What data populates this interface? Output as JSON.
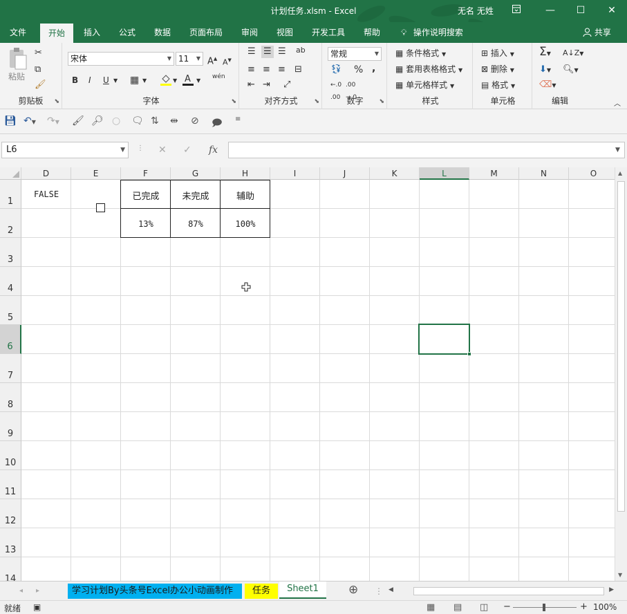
{
  "window": {
    "title": "计划任务.xlsm  -  Excel",
    "user": "无名 无姓",
    "ribbon_display_icon": "ribbon-display-icon",
    "minimize_glyph": "—",
    "maximize_glyph": "☐",
    "close_glyph": "✕"
  },
  "ribbon_tabs": [
    "文件",
    "开始",
    "插入",
    "公式",
    "数据",
    "页面布局",
    "审阅",
    "视图",
    "开发工具",
    "帮助"
  ],
  "active_tab": "开始",
  "tell_me": "操作说明搜索",
  "share": "共享",
  "ribbon": {
    "clipboard": {
      "label": "剪贴板",
      "paste": "粘贴"
    },
    "font": {
      "label": "字体",
      "font_name": "宋体",
      "font_size": "11",
      "bold": "B",
      "italic": "I",
      "underline": "U",
      "grow": "A",
      "shrink": "A",
      "wen": "wén"
    },
    "alignment": {
      "label": "对齐方式",
      "wrap": "ab"
    },
    "number": {
      "label": "数字",
      "format": "常规",
      "percent": "%",
      "comma": ","
    },
    "styles": {
      "label": "样式",
      "conditional": "条件格式",
      "as_table": "套用表格格式",
      "cell_styles": "单元格样式"
    },
    "cells": {
      "label": "单元格",
      "insert": "插入",
      "delete": "删除",
      "format": "格式"
    },
    "editing": {
      "label": "编辑",
      "sigma": "Σ"
    }
  },
  "formula_bar": {
    "name_box": "L6",
    "fx": "fx",
    "cancel": "✕",
    "enter": "✓",
    "formula": ""
  },
  "columns": [
    "D",
    "E",
    "F",
    "G",
    "H",
    "I",
    "J",
    "K",
    "L",
    "M",
    "N",
    "O"
  ],
  "selected_column": "L",
  "rows": [
    "1",
    "2",
    "3",
    "4",
    "5",
    "6",
    "7",
    "8",
    "9",
    "10",
    "11",
    "12",
    "13",
    "14"
  ],
  "selected_row": "6",
  "cells": {
    "D1": "FALSE",
    "F1": "已完成",
    "G1": "未完成",
    "H1": "辅助",
    "F2": "13%",
    "G2": "87%",
    "H2": "100%"
  },
  "checkbox_checked": false,
  "sheets": [
    {
      "name": "学习计划By头条号Excel办公小动画制作",
      "color": "#00b0f0"
    },
    {
      "name": "任务",
      "color": "#ffff00"
    },
    {
      "name": "Sheet1",
      "color": ""
    }
  ],
  "active_sheet": "Sheet1",
  "add_sheet": "⊕",
  "status": {
    "ready": "就绪",
    "zoom": "100%",
    "minus": "−",
    "plus": "+"
  }
}
